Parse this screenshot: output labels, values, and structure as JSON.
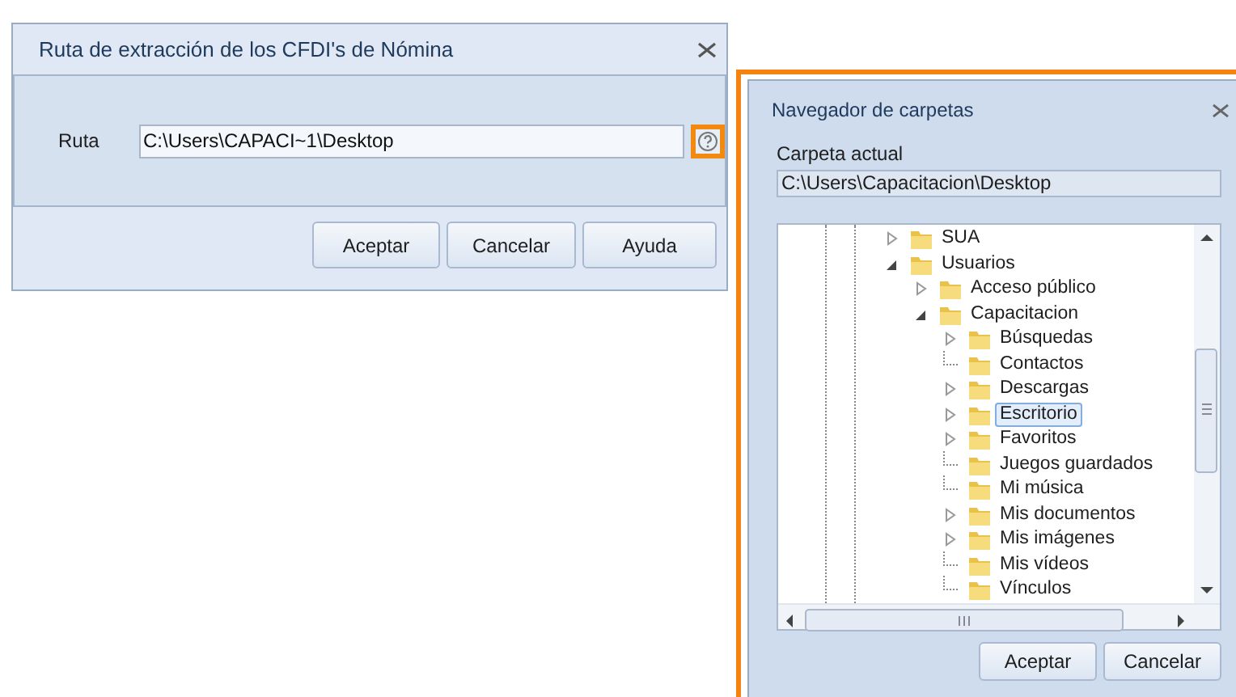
{
  "path_dialog": {
    "title": "Ruta de extracción de los CFDI's de Nómina",
    "field_label": "Ruta",
    "path_value": "C:\\Users\\CAPACI~1\\Desktop",
    "buttons": [
      "Aceptar",
      "Cancelar",
      "Ayuda"
    ]
  },
  "folder_browser": {
    "title": "Navegador de carpetas",
    "current_folder_label": "Carpeta actual",
    "current_folder": "C:\\Users\\Capacitacion\\Desktop",
    "tree": [
      {
        "label": "SUA",
        "kind": "collapsed",
        "selected": false
      },
      {
        "label": "Usuarios",
        "kind": "expanded",
        "selected": false,
        "children": [
          {
            "label": "Acceso público",
            "kind": "collapsed",
            "selected": false
          },
          {
            "label": "Capacitacion",
            "kind": "expanded",
            "selected": false,
            "children": [
              {
                "label": "Búsquedas",
                "kind": "collapsed",
                "selected": false
              },
              {
                "label": "Contactos",
                "kind": "leaf",
                "selected": false
              },
              {
                "label": "Descargas",
                "kind": "collapsed",
                "selected": false
              },
              {
                "label": "Escritorio",
                "kind": "collapsed",
                "selected": true
              },
              {
                "label": "Favoritos",
                "kind": "collapsed",
                "selected": false
              },
              {
                "label": "Juegos guardados",
                "kind": "leaf",
                "selected": false
              },
              {
                "label": "Mi música",
                "kind": "leaf",
                "selected": false
              },
              {
                "label": "Mis documentos",
                "kind": "collapsed",
                "selected": false
              },
              {
                "label": "Mis imágenes",
                "kind": "collapsed",
                "selected": false
              },
              {
                "label": "Mis vídeos",
                "kind": "leaf",
                "selected": false
              },
              {
                "label": "Vínculos",
                "kind": "leaf",
                "selected": false
              }
            ]
          }
        ]
      }
    ],
    "buttons": [
      "Aceptar",
      "Cancelar"
    ]
  }
}
